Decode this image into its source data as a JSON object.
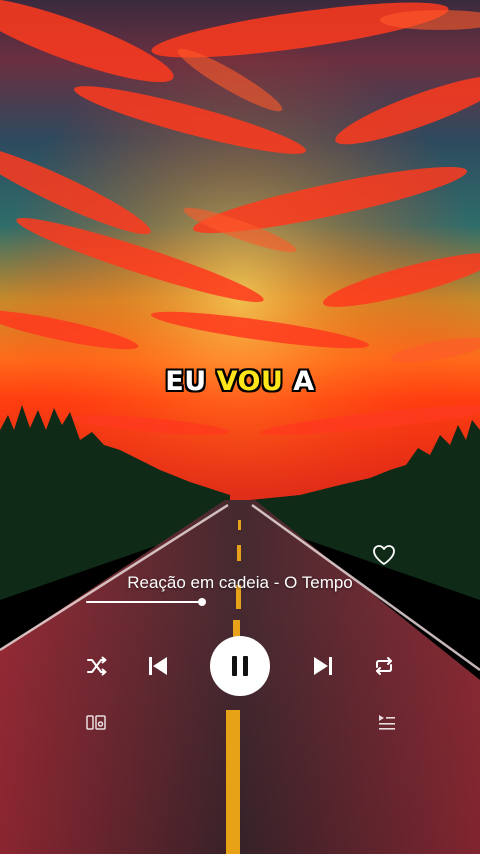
{
  "lyric": {
    "word1": "EU",
    "word2": "VOU",
    "word3": "A"
  },
  "player": {
    "song_title": "Reação em cadeia - O Tempo",
    "progress": 1.0,
    "liked": false
  },
  "icons": {
    "like": "heart-icon",
    "shuffle": "shuffle-icon",
    "previous": "skip-previous-icon",
    "pause": "pause-icon",
    "next": "skip-next-icon",
    "repeat": "repeat-icon",
    "devices": "devices-icon",
    "queue": "queue-icon"
  },
  "colors": {
    "lyric_highlight": "#ffe51a",
    "lyric_text": "#ffffff",
    "controls": "#ffffff"
  }
}
